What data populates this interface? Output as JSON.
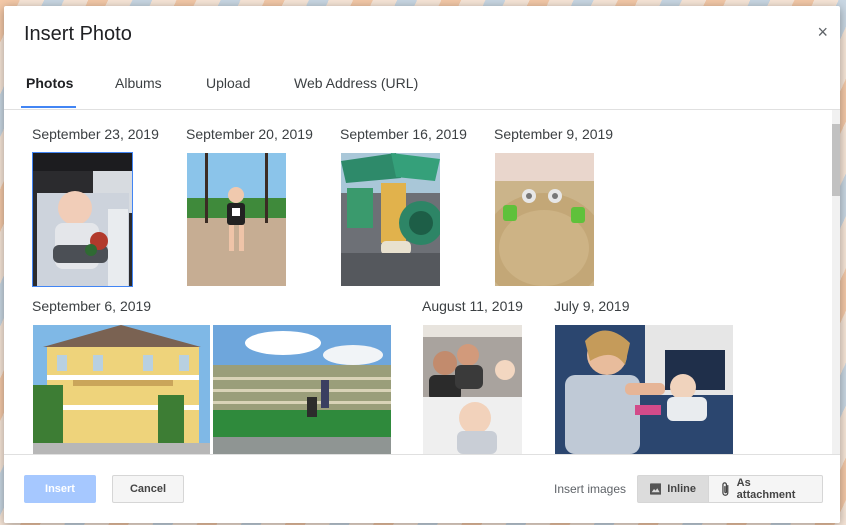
{
  "dialog": {
    "title": "Insert Photo",
    "close_glyph": "×"
  },
  "tabs": [
    {
      "label": "Photos",
      "active": true
    },
    {
      "label": "Albums",
      "active": false
    },
    {
      "label": "Upload",
      "active": false
    },
    {
      "label": "Web Address (URL)",
      "active": false
    }
  ],
  "groups": [
    {
      "date": "September 23, 2019"
    },
    {
      "date": "September 20, 2019"
    },
    {
      "date": "September 16, 2019"
    },
    {
      "date": "September 9, 2019"
    },
    {
      "date": "September 6, 2019"
    },
    {
      "date": "August 11, 2019"
    },
    {
      "date": "July 9, 2019"
    }
  ],
  "footer": {
    "insert_label": "Insert",
    "cancel_label": "Cancel",
    "insert_images_label": "Insert images",
    "inline_label": "Inline",
    "attachment_label": "As attachment",
    "selected_mode": "Inline"
  },
  "icons": {
    "image": "image-icon",
    "paperclip": "paperclip-icon"
  },
  "colors": {
    "accent": "#4285f4",
    "insert_button_disabled": "#a6c8ff"
  }
}
